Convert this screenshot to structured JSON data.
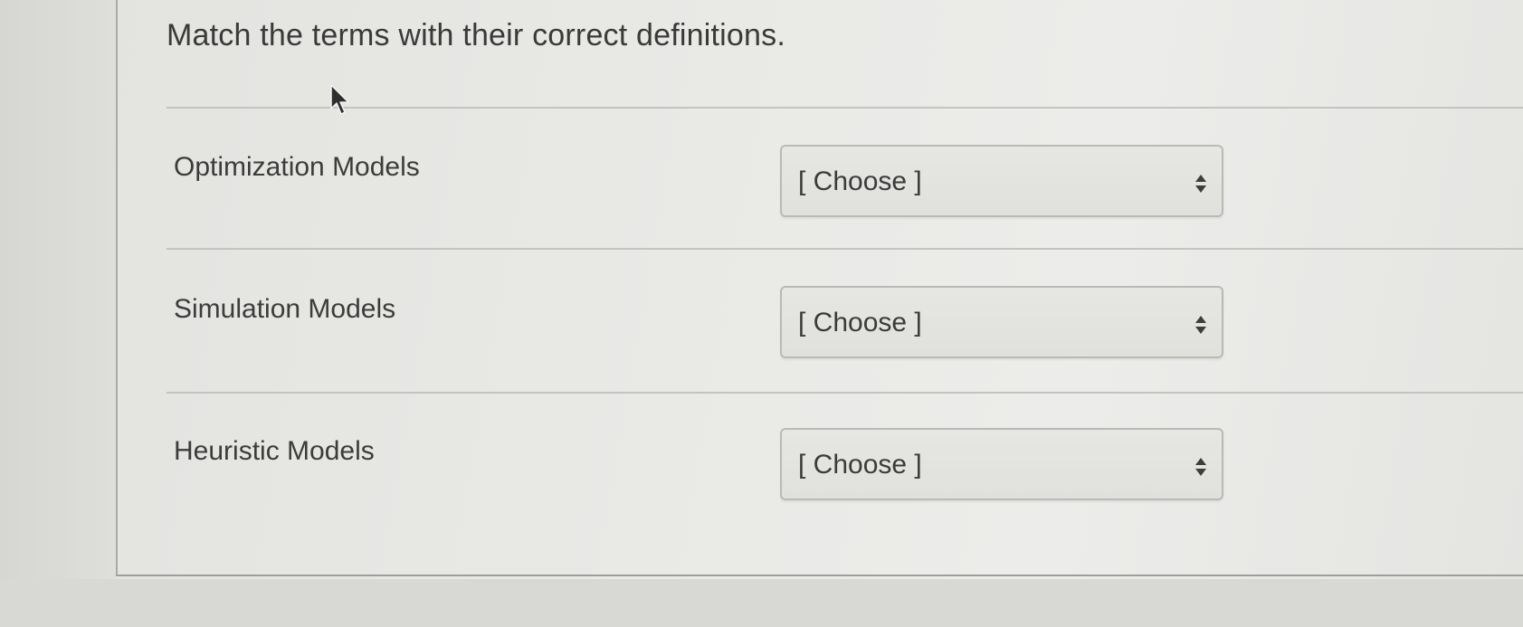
{
  "question": {
    "text": "Match the terms with their correct definitions."
  },
  "items": [
    {
      "term": "Optimization Models",
      "selected": "[ Choose ]"
    },
    {
      "term": "Simulation Models",
      "selected": "[ Choose ]"
    },
    {
      "term": "Heuristic Models",
      "selected": "[ Choose ]"
    }
  ],
  "icons": {
    "dropdown": "updown-arrows-icon",
    "pointer": "mouse-cursor-icon"
  },
  "colors": {
    "background": "#e9e9e6",
    "text": "#3a3a3a",
    "select_border": "#b9b9b6"
  }
}
